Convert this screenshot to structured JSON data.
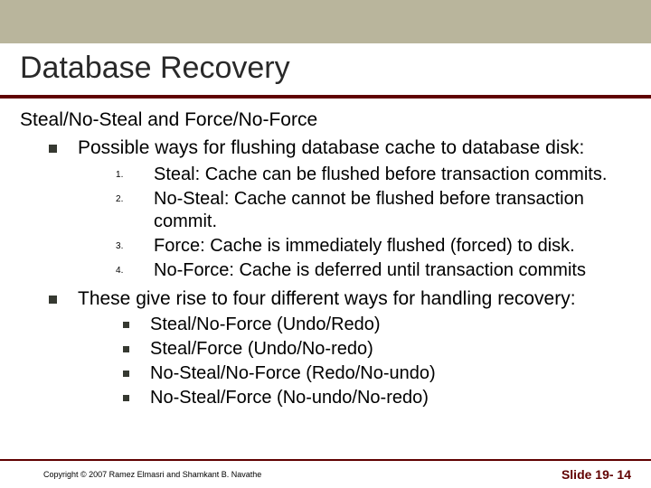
{
  "title": "Database Recovery",
  "subhead": "Steal/No-Steal and Force/No-Force",
  "bullet1": "Possible ways for flushing database cache to database disk:",
  "ordered": {
    "i0": "Steal: Cache can be flushed before transaction commits.",
    "i1": "No-Steal: Cache cannot be flushed before transaction commit.",
    "i2": "Force:  Cache is immediately flushed (forced) to disk.",
    "i3": "No-Force:  Cache is deferred until transaction commits"
  },
  "bullet2": "These give rise to four different ways for handling recovery:",
  "ways": {
    "w0": "Steal/No-Force (Undo/Redo)",
    "w1": "Steal/Force (Undo/No-redo)",
    "w2": "No-Steal/No-Force (Redo/No-undo)",
    "w3": "No-Steal/Force (No-undo/No-redo)"
  },
  "copyright": "Copyright © 2007 Ramez Elmasri and Shamkant B. Navathe",
  "slide_number": "Slide 19- 14"
}
